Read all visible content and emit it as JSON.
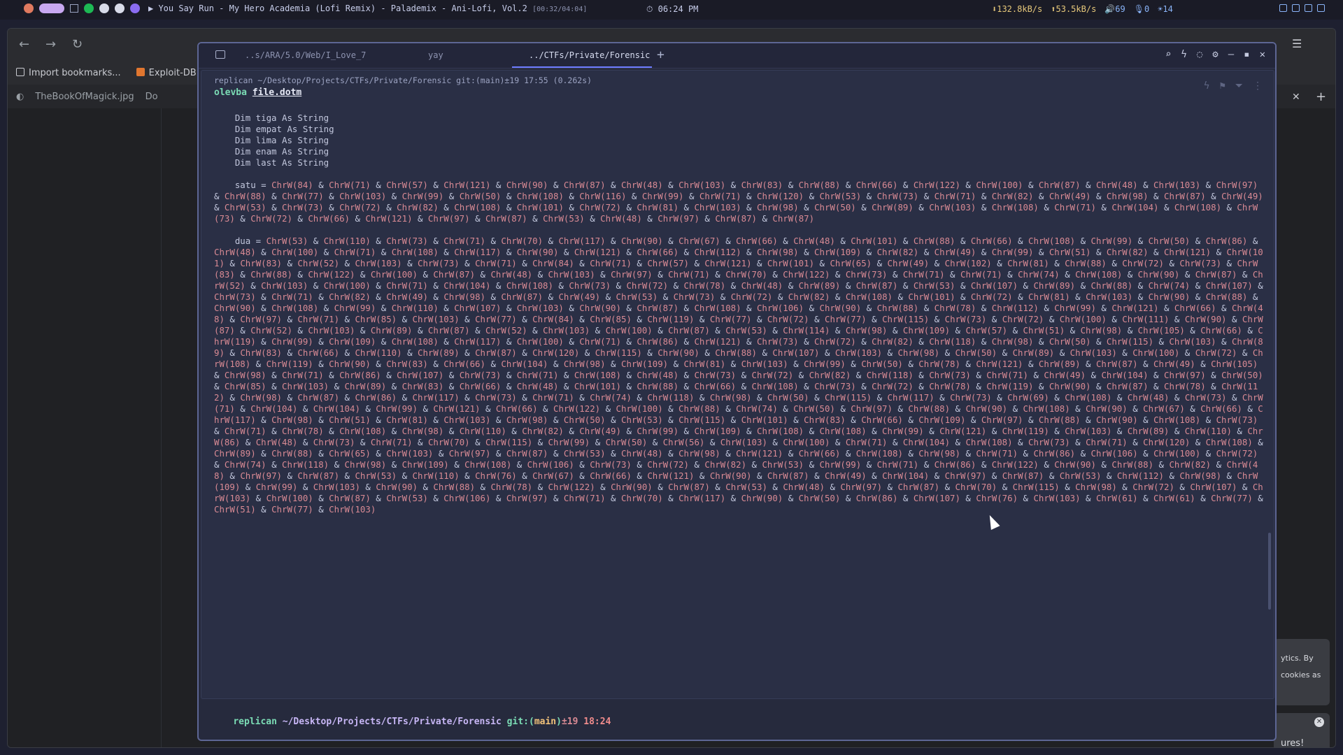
{
  "topbar": {
    "now_playing": "▶ You Say Run - My Hero Academia (Lofi Remix) - Palademix - Ani-Lofi, Vol.2",
    "track_time": "[00:32/04:04]",
    "clock": "06:24 PM",
    "net_down": "132.8kB/s",
    "net_up": "53.5kB/s",
    "volume": "69",
    "mic": "0",
    "brightness": "14"
  },
  "browser": {
    "bookmarks": [
      "Import bookmarks...",
      "Exploit-DB"
    ],
    "tabs": [
      "TheBookOfMagick.jpg",
      "Do"
    ],
    "cookie_text_1": "ytics. By",
    "cookie_text_2": "cookies as",
    "cookie_text_3": "ures!"
  },
  "terminal": {
    "tabs": [
      "..s/ARA/5.0/Web/I_Love_7",
      "yay",
      "../CTFs/Private/Forensic"
    ],
    "block_header": "replican ~/Desktop/Projects/CTFs/Private/Forensic git:(main)±19 17:55 (0.262s)",
    "command": "olevba",
    "command_arg": "file.dotm",
    "prompt": {
      "user": "replican",
      "path": "~/Desktop/Projects/CTFs/Private/Forensic",
      "git": "git:(",
      "branch": "main",
      "git_close": ")",
      "changes": "±19",
      "time": "18:24"
    },
    "code_header": [
      "    Dim tiga As String",
      "    Dim empat As String",
      "    Dim lima As String",
      "    Dim enam As String",
      "    Dim last As String"
    ],
    "assignments": [
      {
        "name": "satu",
        "codes": [
          84,
          71,
          57,
          121,
          90,
          87,
          48,
          103,
          83,
          88,
          66,
          122,
          100,
          87,
          48,
          103,
          97,
          88,
          77,
          103,
          99,
          50,
          108,
          116,
          99,
          71,
          120,
          53,
          73,
          71,
          82,
          49,
          98,
          87,
          49,
          53,
          73,
          72,
          82,
          108,
          101,
          72,
          81,
          103,
          98,
          50,
          89,
          103,
          108,
          71,
          104,
          108,
          73,
          72,
          66,
          121,
          97,
          87,
          53,
          48,
          97,
          87,
          87
        ]
      },
      {
        "name": "dua",
        "codes": [
          53,
          110,
          73,
          71,
          70,
          117,
          90,
          67,
          66,
          48,
          101,
          88,
          66,
          108,
          99,
          50,
          86,
          48,
          100,
          71,
          108,
          117,
          90,
          121,
          66,
          112,
          98,
          109,
          82,
          49,
          99,
          51,
          82,
          121,
          101,
          83,
          52,
          103,
          73,
          71,
          84,
          71,
          57,
          121,
          101,
          65,
          49,
          102,
          81,
          88,
          72,
          73,
          83,
          88,
          122,
          100,
          87,
          48,
          103,
          97,
          71,
          70,
          122,
          73,
          71,
          71,
          74,
          108,
          90,
          87,
          52,
          103,
          100,
          71,
          104,
          108,
          73,
          72,
          78,
          48,
          89,
          87,
          53,
          107,
          89,
          88,
          74,
          107,
          73,
          71,
          82,
          49,
          98,
          87,
          49,
          53,
          73,
          72,
          82,
          108,
          101,
          72,
          81,
          103,
          90,
          88,
          90,
          108,
          99,
          110,
          107,
          103,
          90,
          87,
          108,
          106,
          90,
          88,
          78,
          112,
          99,
          121,
          66,
          48,
          97,
          71,
          85,
          103,
          77,
          84,
          85,
          119,
          77,
          72,
          77,
          115,
          73,
          72,
          100,
          111,
          90,
          87,
          52,
          103,
          89,
          87,
          52,
          103,
          100,
          87,
          53,
          114,
          98,
          109,
          57,
          51,
          98,
          105,
          66,
          119,
          99,
          109,
          108,
          117,
          100,
          71,
          86,
          121,
          73,
          72,
          82,
          118,
          98,
          50,
          115,
          103,
          89,
          83,
          66,
          110,
          89,
          87,
          120,
          115,
          90,
          88,
          107,
          103,
          98,
          50,
          89,
          103,
          100,
          72,
          108,
          119,
          90,
          83,
          66,
          104,
          98,
          109,
          81,
          103,
          99,
          50,
          78,
          121,
          89,
          87,
          49,
          105,
          98,
          71,
          86,
          107,
          73,
          71,
          108,
          48,
          73,
          72,
          82,
          118,
          73,
          71,
          49,
          104,
          97,
          50,
          85,
          103,
          89,
          83,
          66,
          48,
          101,
          88,
          66,
          108,
          73,
          72,
          78,
          119,
          90,
          87,
          78,
          112,
          98,
          87,
          86,
          117,
          73,
          71,
          74,
          118,
          98,
          50,
          115,
          117,
          73,
          69,
          108,
          48,
          73,
          71,
          104,
          104,
          99,
          121,
          66,
          122,
          100,
          88,
          74,
          50,
          97,
          88,
          90,
          108,
          90,
          67,
          66,
          117,
          98,
          51,
          81,
          103,
          98,
          50,
          53,
          115,
          101,
          83,
          66,
          109,
          97,
          88,
          90,
          108,
          73,
          71,
          78,
          108,
          98,
          110,
          82,
          49,
          99,
          109,
          108,
          108,
          99,
          121,
          119,
          103,
          89,
          110,
          86,
          48,
          73,
          71,
          70,
          115,
          99,
          50,
          56,
          103,
          100,
          71,
          104,
          108,
          73,
          71,
          120,
          108,
          89,
          88,
          65,
          103,
          97,
          87,
          53,
          48,
          98,
          121,
          66,
          108,
          98,
          71,
          86,
          106,
          100,
          72,
          74,
          118,
          98,
          109,
          108,
          106,
          73,
          72,
          82,
          53,
          99,
          71,
          86,
          122,
          90,
          88,
          82,
          48,
          97,
          87,
          53,
          110,
          76,
          67,
          66,
          121,
          90,
          87,
          49,
          104,
          97,
          87,
          53,
          112,
          98,
          109,
          99,
          103,
          90,
          88,
          78,
          122,
          90,
          87,
          53,
          48,
          97,
          87,
          70,
          115,
          98,
          72,
          107,
          103,
          100,
          87,
          53,
          106,
          97,
          71,
          70,
          117,
          90,
          50,
          86,
          107,
          76,
          103,
          61,
          61,
          77,
          51,
          77,
          103
        ]
      }
    ]
  }
}
